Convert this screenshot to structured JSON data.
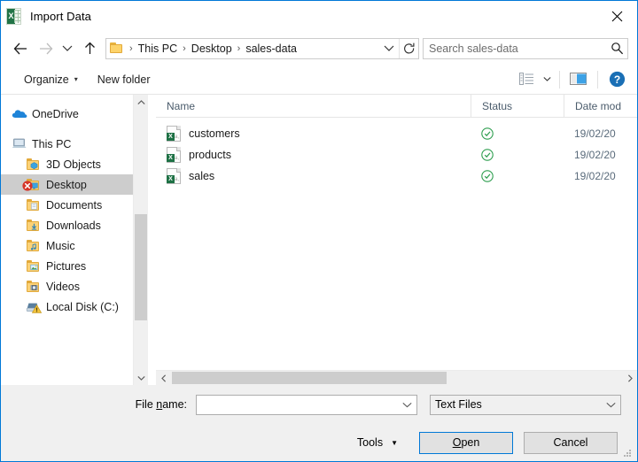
{
  "window": {
    "title": "Import Data",
    "app_icon": "excel-icon",
    "close_label": "✕"
  },
  "nav": {
    "back_icon": "back-arrow-icon",
    "forward_icon": "forward-arrow-icon",
    "recent_icon": "chevron-down-icon",
    "up_icon": "up-arrow-icon",
    "breadcrumb": [
      "This PC",
      "Desktop",
      "sales-data"
    ],
    "breadcrumb_separator": "›",
    "dropdown_icon": "chevron-down-icon",
    "refresh_icon": "refresh-icon",
    "search": {
      "placeholder": "Search sales-data",
      "value": "",
      "icon": "search-icon"
    }
  },
  "command_bar": {
    "organize_label": "Organize",
    "organize_caret": "▾",
    "new_folder_label": "New folder",
    "view_icon": "view-layout-icon",
    "view_caret": "▾",
    "preview_pane_icon": "preview-pane-icon",
    "help_icon": "help-icon",
    "help_glyph": "?"
  },
  "sidebar": {
    "items": [
      {
        "label": "OneDrive",
        "icon": "onedrive-cloud-icon",
        "indent": 12,
        "selected": false,
        "badge": ""
      },
      {
        "label": "This PC",
        "icon": "this-pc-icon",
        "indent": 12,
        "selected": false,
        "badge": ""
      },
      {
        "label": "3D Objects",
        "icon": "folder-3d-objects-icon",
        "indent": 28,
        "selected": false,
        "badge": ""
      },
      {
        "label": "Desktop",
        "icon": "folder-desktop-icon",
        "indent": 28,
        "selected": true,
        "badge": "error-badge"
      },
      {
        "label": "Documents",
        "icon": "folder-documents-icon",
        "indent": 28,
        "selected": false,
        "badge": ""
      },
      {
        "label": "Downloads",
        "icon": "folder-downloads-icon",
        "indent": 28,
        "selected": false,
        "badge": ""
      },
      {
        "label": "Music",
        "icon": "folder-music-icon",
        "indent": 28,
        "selected": false,
        "badge": ""
      },
      {
        "label": "Pictures",
        "icon": "folder-pictures-icon",
        "indent": 28,
        "selected": false,
        "badge": ""
      },
      {
        "label": "Videos",
        "icon": "folder-videos-icon",
        "indent": 28,
        "selected": false,
        "badge": ""
      },
      {
        "label": "Local Disk (C:)",
        "icon": "local-disk-icon",
        "indent": 28,
        "selected": false,
        "badge": "warning-badge"
      }
    ]
  },
  "file_list": {
    "columns": [
      {
        "label": "Name",
        "sorted": "asc",
        "sort_caret": "⌃"
      },
      {
        "label": "Status",
        "sorted": "",
        "sort_caret": ""
      },
      {
        "label": "Date mod",
        "sorted": "",
        "sort_caret": ""
      }
    ],
    "rows": [
      {
        "name": "customers",
        "icon": "csv-file-icon",
        "status_icon": "sync-ok-icon",
        "date": "19/02/20"
      },
      {
        "name": "products",
        "icon": "csv-file-icon",
        "status_icon": "sync-ok-icon",
        "date": "19/02/20"
      },
      {
        "name": "sales",
        "icon": "csv-file-icon",
        "status_icon": "sync-ok-icon",
        "date": "19/02/20"
      }
    ]
  },
  "footer": {
    "file_name_label_pre": "File ",
    "file_name_label_mnemonic": "n",
    "file_name_label_post": "ame:",
    "file_name_value": "",
    "file_name_placeholder": "",
    "file_type_value": "Text Files",
    "tools_label": "Tools",
    "tools_caret": "▼",
    "open_label": "Open",
    "open_mnemonic": "O",
    "open_label_rest": "pen",
    "cancel_label": "Cancel",
    "resize_grip": "resize-grip-icon"
  },
  "colors": {
    "accent": "#0078d7",
    "excel_green": "#217346",
    "status_green": "#2e9e4f",
    "error_red": "#d5342a",
    "selection_gray": "#cdcdcd"
  }
}
